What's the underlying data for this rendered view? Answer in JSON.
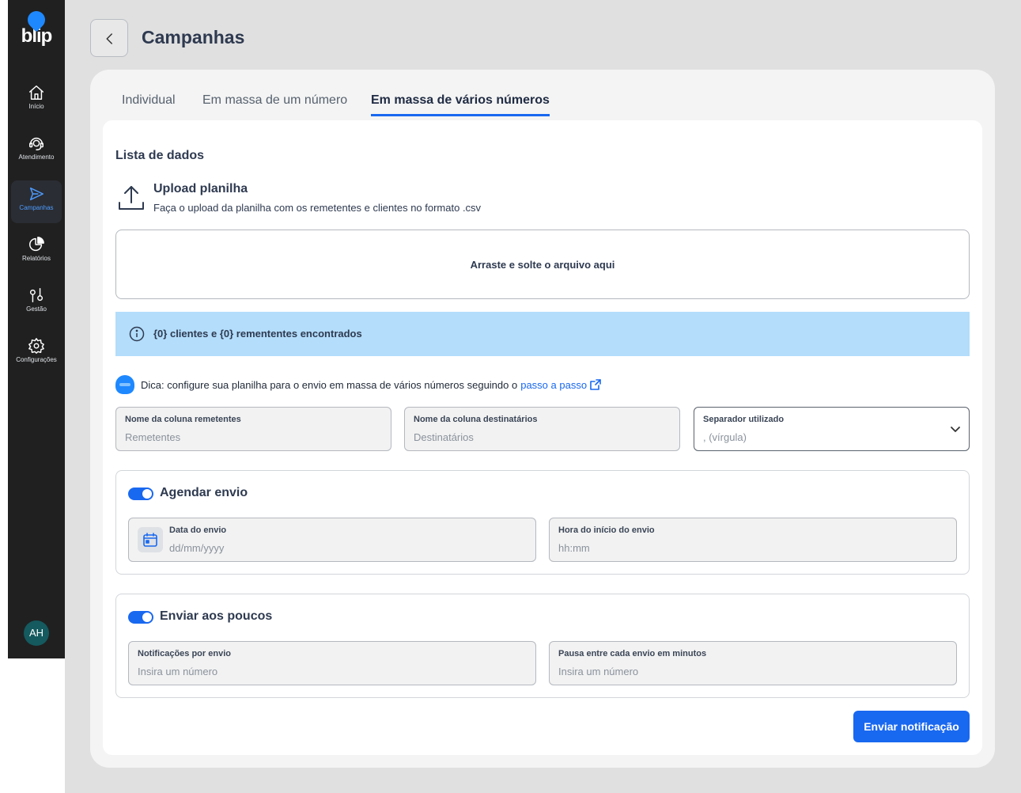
{
  "brand": {
    "logo_text": "blip",
    "accent": "#1968f0"
  },
  "sidebar": {
    "items": [
      {
        "label": "Início",
        "icon": "home-icon"
      },
      {
        "label": "Atendimento",
        "icon": "headset-icon"
      },
      {
        "label": "Campanhas",
        "icon": "send-icon",
        "active": true
      },
      {
        "label": "Relatórios",
        "icon": "pie-chart-icon"
      },
      {
        "label": "Gestão",
        "icon": "sliders-icon"
      },
      {
        "label": "Configurações",
        "icon": "gear-icon"
      }
    ],
    "avatar_initials": "AH"
  },
  "header": {
    "title": "Campanhas"
  },
  "tabs": [
    {
      "label": "Individual"
    },
    {
      "label": "Em massa de um número"
    },
    {
      "label": "Em massa de vários números",
      "active": true
    }
  ],
  "form": {
    "section_title": "Lista de dados",
    "upload": {
      "title": "Upload planilha",
      "description": "Faça o upload da planilha com os remetentes e clientes no formato .csv",
      "dropzone_text": "Arraste e solte o arquivo aqui"
    },
    "info_text": "{0} clientes e {0} remententes encontrados",
    "tip": {
      "text": "Dica: configure sua planilha para o envio em massa de vários números seguindo o",
      "link_text": "passo a passo"
    },
    "fields": {
      "senders": {
        "label": "Nome da coluna remetentes",
        "placeholder": "Remetentes"
      },
      "recipients": {
        "label": "Nome da coluna destinatários",
        "placeholder": "Destinatários"
      },
      "separator": {
        "label": "Separador utilizado",
        "value": ", (vírgula)"
      }
    },
    "schedule": {
      "title": "Agendar envio",
      "enabled": true,
      "date": {
        "label": "Data do envio",
        "placeholder": "dd/mm/yyyy"
      },
      "time": {
        "label": "Hora do início do envio",
        "placeholder": "hh:mm"
      }
    },
    "throttle": {
      "title": "Enviar aos poucos",
      "enabled": true,
      "per_send": {
        "label": "Notificações por envio",
        "placeholder": "Insira um número"
      },
      "pause": {
        "label": "Pausa entre cada envio em minutos",
        "placeholder": "Insira um número"
      }
    },
    "submit_label": "Enviar notificação"
  }
}
